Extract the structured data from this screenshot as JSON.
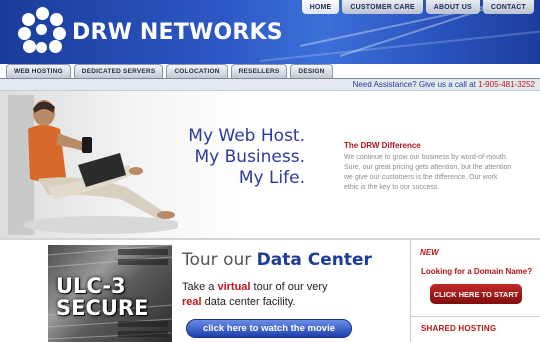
{
  "brand": {
    "name": "DRW NETWORKS"
  },
  "top_tabs": [
    {
      "label": "HOME",
      "active": true
    },
    {
      "label": "CUSTOMER CARE",
      "active": false
    },
    {
      "label": "ABOUT US",
      "active": false
    },
    {
      "label": "CONTACT",
      "active": false
    }
  ],
  "nav_tabs": [
    {
      "label": "WEB HOSTING"
    },
    {
      "label": "DEDICATED SERVERS"
    },
    {
      "label": "COLOCATION"
    },
    {
      "label": "RESELLERS"
    },
    {
      "label": "DESIGN"
    }
  ],
  "assist": {
    "text": "Need Assistance? Give us a call at ",
    "phone": "1-905-481-3252"
  },
  "hero": {
    "tagline_lines": [
      "My Web Host.",
      "My Business.",
      "My Life."
    ],
    "diff_title": "The DRW Difference",
    "diff_body": "We continue to grow our business by word-of-mouth. Sure, our great pricing gets attention, but the attention we give our customers is the difference. Our work ethic is the key to our success."
  },
  "tour": {
    "image_lines": [
      "ULC-3",
      "SECURE"
    ],
    "title_pre": "Tour our ",
    "title_hl": "Data Center",
    "line1_pre": "Take a ",
    "line1_red": "virtual",
    "line1_post": " tour of our very",
    "line2_red": "real",
    "line2_post": " data center facility.",
    "button": "click here to watch the movie"
  },
  "right": {
    "new_badge": "NEW",
    "domain_q": "Looking for a Domain Name?",
    "start_button": "CLICK HERE TO START",
    "shared": "SHARED HOSTING"
  },
  "colors": {
    "brand_blue": "#2b57c4",
    "accent_red": "#c0181b",
    "tagline_blue": "#2c3aa0"
  }
}
